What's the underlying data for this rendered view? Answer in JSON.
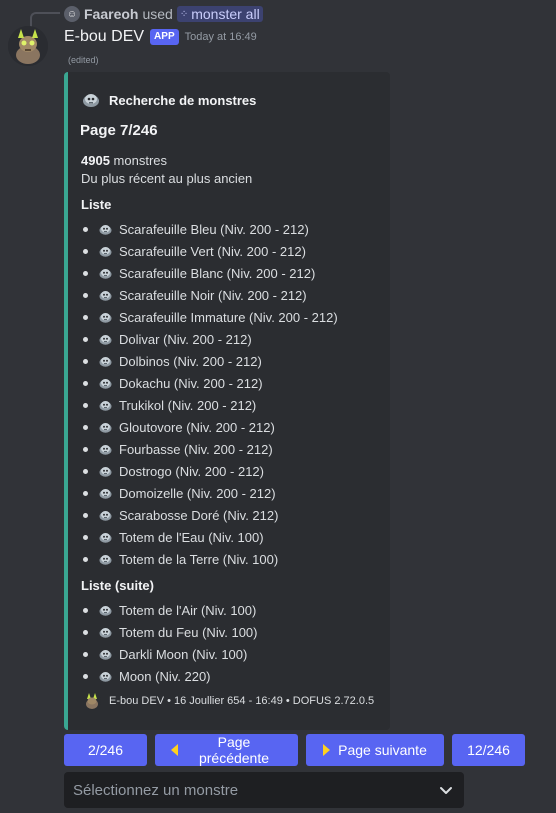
{
  "reply": {
    "user": "Faareoh",
    "used": "used",
    "command": "monster all"
  },
  "message": {
    "bot_name": "E-bou DEV",
    "app_tag": "APP",
    "timestamp": "Today at 16:49",
    "edited": "(edited)"
  },
  "embed": {
    "author": "Recherche de monstres",
    "title": "Page 7/246",
    "count_number": "4905",
    "count_label": "monstres",
    "sort": "Du plus récent au plus ancien",
    "field1_name": "Liste",
    "field1_items": [
      "Scarafeuille Bleu (Niv. 200 - 212)",
      "Scarafeuille Vert (Niv. 200 - 212)",
      "Scarafeuille Blanc (Niv. 200 - 212)",
      "Scarafeuille Noir (Niv. 200 - 212)",
      "Scarafeuille Immature (Niv. 200 - 212)",
      "Dolivar (Niv. 200 - 212)",
      "Dolbinos (Niv. 200 - 212)",
      "Dokachu (Niv. 200 - 212)",
      "Trukikol (Niv. 200 - 212)",
      "Gloutovore (Niv. 200 - 212)",
      "Fourbasse (Niv. 200 - 212)",
      "Dostrogo (Niv. 200 - 212)",
      "Domoizelle (Niv. 200 - 212)",
      "Scarabosse Doré (Niv. 212)",
      "Totem de l'Eau (Niv. 100)",
      "Totem de la Terre (Niv. 100)"
    ],
    "field2_name": "Liste (suite)",
    "field2_items": [
      "Totem de l'Air (Niv. 100)",
      "Totem du Feu (Niv. 100)",
      "Darkli Moon (Niv. 100)",
      "Moon (Niv. 220)"
    ],
    "footer": "E-bou DEV • 16 Joullier 654 - 16:49 • DOFUS 2.72.0.5",
    "accent_color": "#3aa792"
  },
  "buttons": {
    "first": "2/246",
    "prev": "Page précédente",
    "next": "Page suivante",
    "last": "12/246"
  },
  "select": {
    "placeholder": "Sélectionnez un monstre"
  },
  "colors": {
    "background": "#313338",
    "embed_bg": "#2b2d31",
    "blurple": "#5865f2",
    "arrow": "#ffd21f"
  },
  "icons": {
    "monster": "monster-skull-icon",
    "avatar": "bot-avatar-icon",
    "chevron": "chevron-down-icon"
  }
}
